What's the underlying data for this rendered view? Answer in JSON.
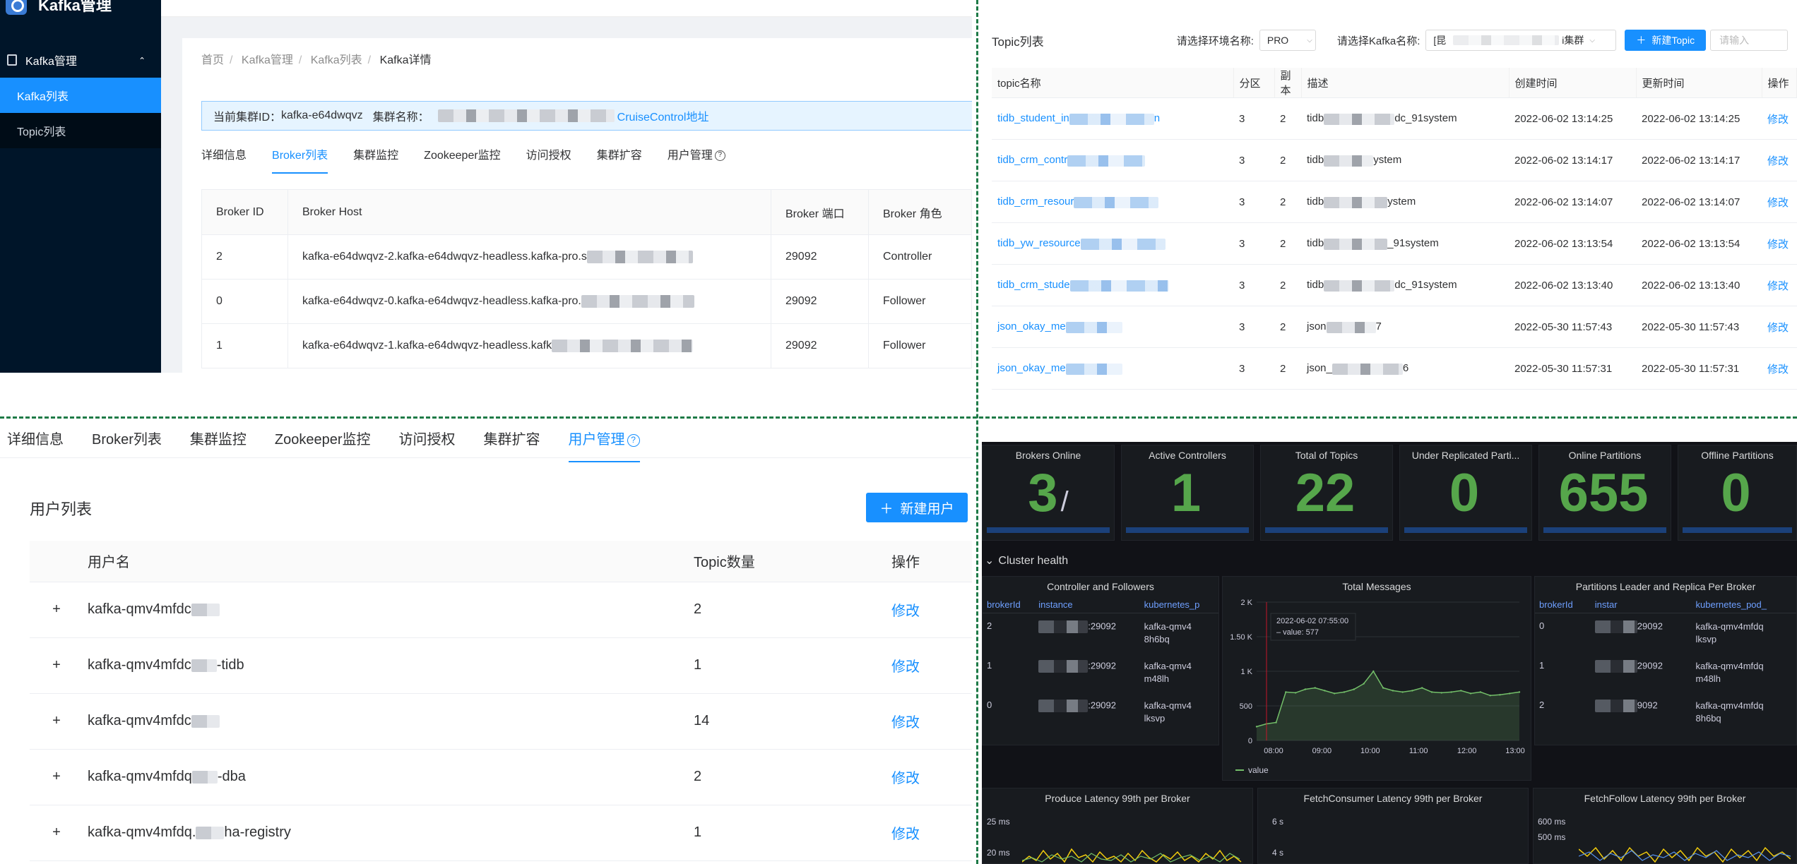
{
  "q1": {
    "app_title": "Kafka管理",
    "sidebar": {
      "group_label": "Kafka管理",
      "items": [
        {
          "label": "Kafka列表",
          "active": true
        },
        {
          "label": "Topic列表",
          "active": false
        }
      ]
    },
    "breadcrumb": [
      "首页",
      "Kafka管理",
      "Kafka列表",
      "Kafka详情"
    ],
    "alert": {
      "cluster_id_label": "当前集群ID：",
      "cluster_id": "kafka-e64dwqvz",
      "cluster_name_label": "集群名称：",
      "link": "CruiseControl地址"
    },
    "tabs": [
      "详细信息",
      "Broker列表",
      "集群监控",
      "Zookeeper监控",
      "访问授权",
      "集群扩容",
      "用户管理"
    ],
    "active_tab": "Broker列表",
    "table": {
      "headers": [
        "Broker ID",
        "Broker Host",
        "Broker 端口",
        "Broker 角色"
      ],
      "rows": [
        {
          "id": "2",
          "host": "kafka-e64dwqvz-2.kafka-e64dwqvz-headless.kafka-pro.s",
          "port": "29092",
          "role": "Controller"
        },
        {
          "id": "0",
          "host": "kafka-e64dwqvz-0.kafka-e64dwqvz-headless.kafka-pro.",
          "port": "29092",
          "role": "Follower"
        },
        {
          "id": "1",
          "host": "kafka-e64dwqvz-1.kafka-e64dwqvz-headless.kafk",
          "port": "29092",
          "role": "Follower"
        }
      ]
    }
  },
  "q2": {
    "title": "Topic列表",
    "env_label": "请选择环境名称:",
    "env_value": "PRO",
    "kafka_label": "请选择Kafka名称:",
    "kafka_value": "[昆",
    "kafka_value_suffix": "i集群",
    "new_button": "新建Topic",
    "search_placeholder": "请输入",
    "table": {
      "headers": [
        "topic名称",
        "分区",
        "副本",
        "描述",
        "创建时间",
        "更新时间",
        "操作"
      ],
      "rows": [
        {
          "name": "tidb_student_in",
          "name_tail": "n",
          "partitions": "3",
          "replicas": "2",
          "desc": "tidb",
          "desc_tail": "dc_91system",
          "created": "2022-06-02 13:14:25",
          "updated": "2022-06-02 13:14:25",
          "action": "修改"
        },
        {
          "name": "tidb_crm_contr",
          "name_tail": "",
          "partitions": "3",
          "replicas": "2",
          "desc": "tidb",
          "desc_tail": "ystem",
          "created": "2022-06-02 13:14:17",
          "updated": "2022-06-02 13:14:17",
          "action": "修改"
        },
        {
          "name": "tidb_crm_resour",
          "name_tail": "",
          "partitions": "3",
          "replicas": "2",
          "desc": "tidb",
          "desc_tail": "ystem",
          "created": "2022-06-02 13:14:07",
          "updated": "2022-06-02 13:14:07",
          "action": "修改"
        },
        {
          "name": "tidb_yw_resource",
          "name_tail": "",
          "partitions": "3",
          "replicas": "2",
          "desc": "tidb",
          "desc_tail": "_91system",
          "created": "2022-06-02 13:13:54",
          "updated": "2022-06-02 13:13:54",
          "action": "修改"
        },
        {
          "name": "tidb_crm_stude",
          "name_tail": "",
          "partitions": "3",
          "replicas": "2",
          "desc": "tidb",
          "desc_tail": "dc_91system",
          "created": "2022-06-02 13:13:40",
          "updated": "2022-06-02 13:13:40",
          "action": "修改"
        },
        {
          "name": "json_okay_me",
          "name_tail": "",
          "partitions": "3",
          "replicas": "2",
          "desc": "json",
          "desc_tail": "7",
          "created": "2022-05-30 11:57:43",
          "updated": "2022-05-30 11:57:43",
          "action": "修改"
        },
        {
          "name": "json_okay_me",
          "name_tail": "",
          "partitions": "3",
          "replicas": "2",
          "desc": "json_",
          "desc_tail": "6",
          "created": "2022-05-30 11:57:31",
          "updated": "2022-05-30 11:57:31",
          "action": "修改"
        }
      ]
    }
  },
  "q3": {
    "tabs": [
      "详细信息",
      "Broker列表",
      "集群监控",
      "Zookeeper监控",
      "访问授权",
      "集群扩容",
      "用户管理"
    ],
    "active_tab": "用户管理",
    "title": "用户列表",
    "new_button": "新建用户",
    "table": {
      "headers": [
        "用户名",
        "Topic数量",
        "操作"
      ],
      "rows": [
        {
          "expand": "+",
          "name": "kafka-qmv4mfdc",
          "name_tail": "",
          "count": "2",
          "action": "修改"
        },
        {
          "expand": "+",
          "name": "kafka-qmv4mfdc",
          "name_tail": "-tidb",
          "count": "1",
          "action": "修改"
        },
        {
          "expand": "+",
          "name": "kafka-qmv4mfdc",
          "name_tail": "",
          "count": "14",
          "action": "修改"
        },
        {
          "expand": "+",
          "name": "kafka-qmv4mfdq",
          "name_tail": "-dba",
          "count": "2",
          "action": "修改"
        },
        {
          "expand": "+",
          "name": "kafka-qmv4mfdq.",
          "name_tail": "ha-registry",
          "count": "1",
          "action": "修改"
        }
      ]
    }
  },
  "q4": {
    "stats": [
      {
        "title": "Brokers Online",
        "value": "3",
        "suffix": "/"
      },
      {
        "title": "Active Controllers",
        "value": "1",
        "suffix": ""
      },
      {
        "title": "Total of Topics",
        "value": "22",
        "suffix": ""
      },
      {
        "title": "Under Replicated Parti...",
        "value": "0",
        "suffix": ""
      },
      {
        "title": "Online Partitions",
        "value": "655",
        "suffix": ""
      },
      {
        "title": "Offline Partitions",
        "value": "0",
        "suffix": ""
      }
    ],
    "row_title": "Cluster health",
    "controller_panel": {
      "title": "Controller and Followers",
      "headers": [
        "brokerId",
        "instance",
        "kubernetes_p"
      ],
      "rows": [
        {
          "brokerId": "2",
          "instance": ":29092",
          "pod": "kafka-qmv4\n8h6bq"
        },
        {
          "brokerId": "1",
          "instance": ":29092",
          "pod": "kafka-qmv4\nm48lh"
        },
        {
          "brokerId": "0",
          "instance": ":29092",
          "pod": "kafka-qmv4\nlksvp"
        }
      ]
    },
    "messages_panel": {
      "title": "Total Messages",
      "tooltip_time": "2022-06-02 07:55:00",
      "tooltip_label": "value:",
      "tooltip_value": "577",
      "legend": "value"
    },
    "partitions_panel": {
      "title": "Partitions Leader and Replica Per Broker",
      "headers": [
        "brokerId",
        "instar",
        "kubernetes_pod_"
      ],
      "rows": [
        {
          "brokerId": "0",
          "instance": "29092",
          "pod": "kafka-qmv4mfdq\nlksvp"
        },
        {
          "brokerId": "1",
          "instance": "29092",
          "pod": "kafka-qmv4mfdq\nm48lh"
        },
        {
          "brokerId": "2",
          "instance": "9092",
          "pod": "kafka-qmv4mfdq\n8h6bq"
        }
      ]
    },
    "latency_panels": [
      {
        "title": "Produce Latency 99th per Broker",
        "y_ticks": [
          "25 ms",
          "20 ms"
        ]
      },
      {
        "title": "FetchConsumer Latency 99th per Broker",
        "y_ticks": [
          "6 s",
          "4 s"
        ]
      },
      {
        "title": "FetchFollow Latency 99th per Broker",
        "y_ticks": [
          "600 ms",
          "500 ms"
        ]
      }
    ],
    "colors": {
      "stat_green": "#56a64b",
      "panel_bg": "#181b1f",
      "header_blue": "#6e9fff"
    }
  },
  "chart_data": {
    "type": "line",
    "title": "Total Messages",
    "x": [
      "08:00",
      "09:00",
      "10:00",
      "11:00",
      "12:00",
      "13:00"
    ],
    "y_ticks": [
      "0",
      "500",
      "1 K",
      "1.50 K",
      "2 K"
    ],
    "ylim": [
      0,
      2000
    ],
    "series": [
      {
        "name": "value",
        "values": [
          200,
          240,
          260,
          700,
          690,
          740,
          760,
          720,
          680,
          700,
          740,
          820,
          1000,
          760,
          720,
          700,
          720,
          760,
          700,
          690,
          700,
          720,
          680,
          700,
          650,
          660,
          680,
          700
        ]
      }
    ],
    "legend": "bottom-left",
    "tooltip": {
      "time": "2022-06-02 07:55:00",
      "value": 577
    }
  }
}
